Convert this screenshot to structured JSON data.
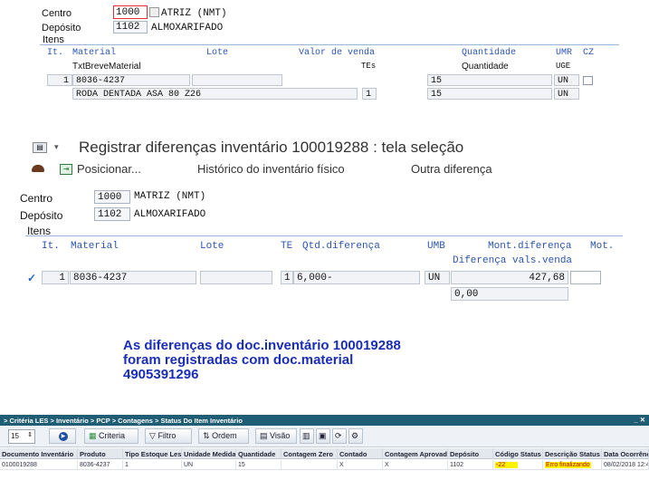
{
  "top_panel": {
    "centro_label": "Centro",
    "centro_value": "1000",
    "centro_desc": "ATRIZ (NMT)",
    "deposito_label": "Depósito",
    "deposito_value": "1102",
    "deposito_desc": "ALMOXARIFADO",
    "itens_label": "Itens",
    "headers": {
      "it": "It.",
      "material": "Material",
      "lote": "Lote",
      "valor": "Valor de venda",
      "quantidade": "Quantidade",
      "umr": "UMR",
      "cz": "CZ"
    },
    "subheaders": {
      "txt": "TxtBreveMaterial",
      "tes": "TEs",
      "quantidade": "Quantidade",
      "uge": "UGE"
    },
    "row": {
      "it": "1",
      "material": "8036-4237",
      "quantidade": "15",
      "um": "UN"
    },
    "subrow": {
      "desc": "RODA DENTADA ASA 80 Z26",
      "te": "1",
      "quantidade": "15",
      "um": "UN"
    }
  },
  "mid_panel": {
    "title": "Registrar diferenças inventário 100019288 : tela seleção",
    "toolbar": {
      "posicionar": "Posicionar...",
      "historico": "Histórico do inventário físico",
      "outra": "Outra diferença"
    },
    "centro_label": "Centro",
    "centro_value": "1000",
    "centro_desc": "MATRIZ (NMT)",
    "deposito_label": "Depósito",
    "deposito_value": "1102",
    "deposito_desc": "ALMOXARIFADO",
    "itens_label": "Itens",
    "headers": {
      "it": "It.",
      "material": "Material",
      "lote": "Lote",
      "te": "TE",
      "qtd": "Qtd.diferença",
      "umb": "UMB",
      "mont": "Mont.diferença",
      "mot": "Mot.",
      "dif_vals": "Diferença vals.venda"
    },
    "row": {
      "it": "1",
      "material": "8036-4237",
      "te": "1",
      "qtd": "6,000-",
      "umb": "UN",
      "mont": "427,68",
      "dif_vals": "0,00"
    }
  },
  "message": {
    "line1": "As diferenças do doc.inventário 100019288",
    "line2": "foram registradas com doc.material",
    "line3": "4905391296"
  },
  "bottom_panel": {
    "breadcrumb": "> Critéria LES > Inventário > PCP > Contagens > Status Do Item Inventário",
    "window_controls": "_ ✕",
    "page_size": "15",
    "toolbar": {
      "criteria": "Criteria",
      "filtro": "Filtro",
      "ordem": "Ordem",
      "visao": "Visão"
    },
    "columns": [
      "Documento Inventário",
      "Produto",
      "Tipo Estoque Les",
      "Unidade Medida",
      "Quantidade",
      "Contagem Zero",
      "Contado",
      "Contagem Aprovada",
      "Depósito",
      "Código Status",
      "Descrição Status",
      "Data Ocorrência"
    ],
    "row": [
      "0100019288",
      "8036-4237",
      "1",
      "UN",
      "15",
      "",
      "X",
      "X",
      "1102",
      "-22",
      "Erro finalizando",
      "08/02/2018 12:4"
    ]
  },
  "colors": {
    "sap_blue": "#2c55b0",
    "header_bar": "#1f5d74",
    "highlight": "#fff200",
    "message": "#1a2db8"
  }
}
